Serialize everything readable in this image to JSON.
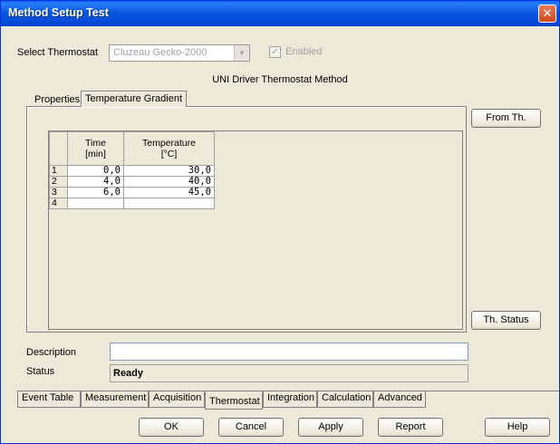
{
  "window": {
    "title": "Method Setup Test",
    "close": "✕"
  },
  "thermostat": {
    "label": "Select Thermostat",
    "selected": "Cluzeau Gecko-2000",
    "enabled_label": "Enabled",
    "enabled_mark": "✓",
    "combo_arrow": "▼"
  },
  "method_title": "UNI Driver Thermostat Method",
  "inner_tabs": [
    "Properties",
    "Temperature Gradient"
  ],
  "side_buttons": {
    "from": "From Th.",
    "status": "Th. Status"
  },
  "table": {
    "headers": [
      "Time\n[min]",
      "Temperature\n[°C]"
    ],
    "rows": [
      {
        "n": "1",
        "time": "0,0",
        "temp": "30,0"
      },
      {
        "n": "2",
        "time": "4,0",
        "temp": "40,0"
      },
      {
        "n": "3",
        "time": "6,0",
        "temp": "45,0"
      },
      {
        "n": "4",
        "time": "",
        "temp": ""
      }
    ]
  },
  "description": {
    "label": "Description",
    "value": ""
  },
  "status": {
    "label": "Status",
    "value": "Ready"
  },
  "bottom_tabs": [
    "Event Table",
    "Measurement",
    "Acquisition",
    "Thermostat",
    "Integration",
    "Calculation",
    "Advanced"
  ],
  "buttons": {
    "ok": "OK",
    "cancel": "Cancel",
    "apply": "Apply",
    "report": "Report",
    "help": "Help"
  },
  "colors": {
    "title_bar": "#0a58e0",
    "close_button": "#d04a1a",
    "dialog_bg": "#ece9d8"
  }
}
